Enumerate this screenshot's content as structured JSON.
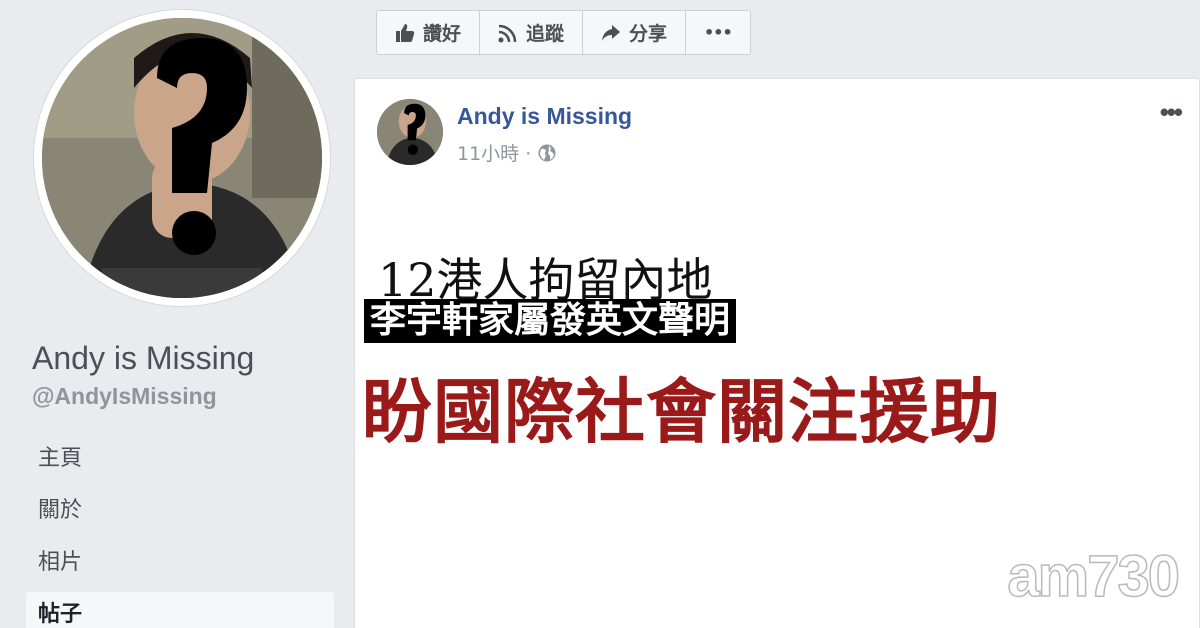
{
  "profile": {
    "name": "Andy is Missing",
    "handle": "@AndyIsMissing"
  },
  "nav": {
    "items": [
      {
        "label": "主頁",
        "active": false
      },
      {
        "label": "關於",
        "active": false
      },
      {
        "label": "相片",
        "active": false
      },
      {
        "label": "帖子",
        "active": true
      }
    ]
  },
  "actions": {
    "like": {
      "label": "讚好",
      "icon": "thumbs-up-icon"
    },
    "follow": {
      "label": "追蹤",
      "icon": "rss-icon"
    },
    "share": {
      "label": "分享",
      "icon": "share-arrow-icon"
    },
    "more": {
      "label": "•••",
      "icon": "more-dots-icon"
    }
  },
  "post": {
    "author": "Andy is Missing",
    "time": "11小時 ·",
    "privacy_icon": "globe-icon",
    "menu": "•••"
  },
  "headline": {
    "line1": "12港人拘留內地",
    "line2": "李宇軒家屬發英文聲明",
    "line3": "盼國際社會關注援助"
  },
  "watermark": "am730",
  "colors": {
    "link_blue": "#365899",
    "headline_red": "#9a1a1a",
    "background": "#e9ebee"
  }
}
